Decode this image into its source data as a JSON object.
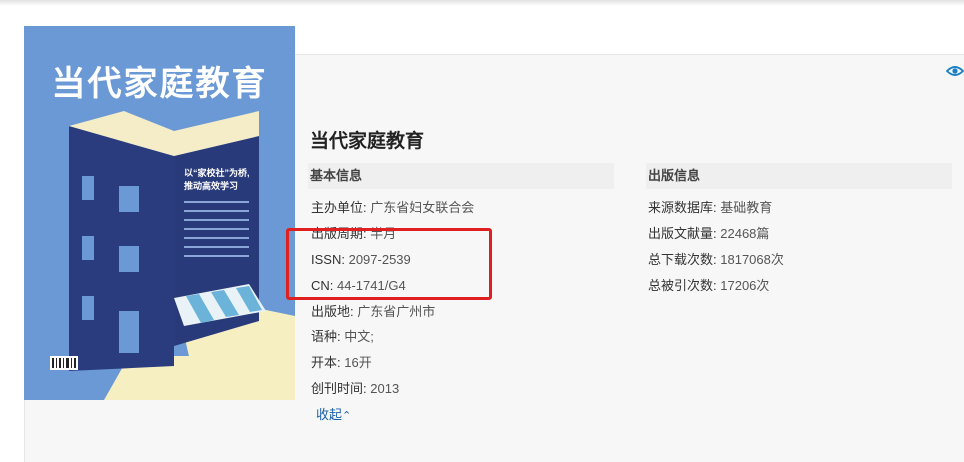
{
  "cover": {
    "title": "当代家庭教育",
    "slogan_line1": "以“家校社”为桥,",
    "slogan_line2": "推动高效学习"
  },
  "journal": {
    "title": "当代家庭教育"
  },
  "sections": {
    "basic": "基本信息",
    "publishing": "出版信息"
  },
  "basic_info": [
    {
      "label": "主办单位:",
      "value": "广东省妇女联合会"
    },
    {
      "label": "出版周期:",
      "value": "半月"
    },
    {
      "label": "ISSN:",
      "value": "2097-2539"
    },
    {
      "label": "CN:",
      "value": "44-1741/G4"
    },
    {
      "label": "出版地:",
      "value": "广东省广州市"
    },
    {
      "label": "语种:",
      "value": "中文;"
    },
    {
      "label": "开本:",
      "value": "16开"
    },
    {
      "label": "创刊时间:",
      "value": "2013"
    }
  ],
  "pub_info": [
    {
      "label": "来源数据库:",
      "value": "基础教育"
    },
    {
      "label": "出版文献量:",
      "value": "22468篇"
    },
    {
      "label": "总下载次数:",
      "value": "1817068次"
    },
    {
      "label": "总被引次数:",
      "value": "17206次"
    }
  ],
  "collapse_label": "收起",
  "colors": {
    "link": "#1a5fa8",
    "highlight": "#e02020",
    "cover_bg": "#6a99d5"
  }
}
